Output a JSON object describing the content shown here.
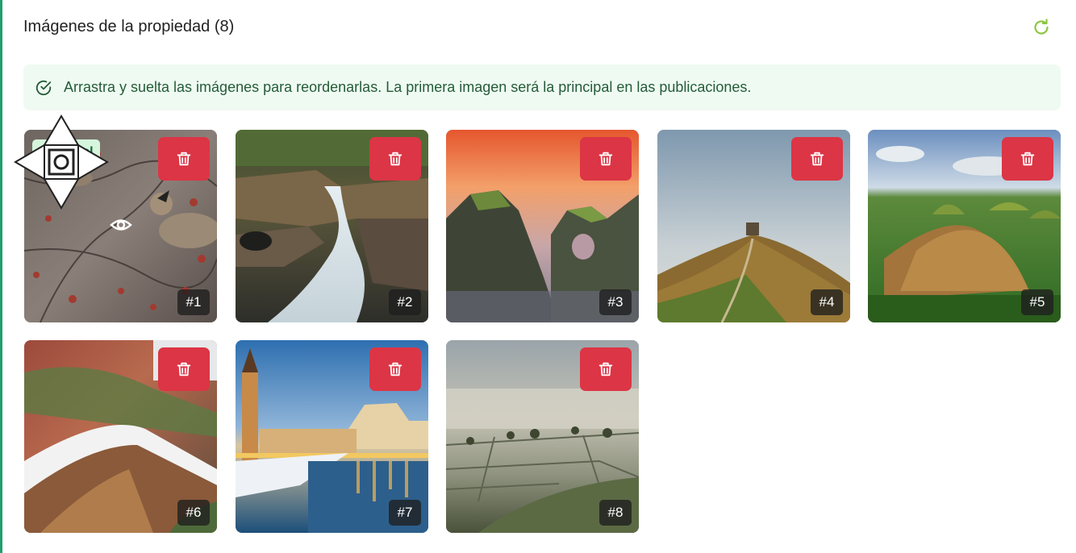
{
  "header": {
    "title": "Imágenes de la propiedad (8)",
    "refresh_icon": "refresh-icon"
  },
  "info": {
    "icon": "check-circle-icon",
    "text": "Arrastra y suelta las imágenes para reordenarlas. La primera imagen será la principal en las publicaciones."
  },
  "gallery": {
    "principal_label": "Principal",
    "delete_icon": "trash-icon",
    "images": [
      {
        "number": "#1"
      },
      {
        "number": "#2"
      },
      {
        "number": "#3"
      },
      {
        "number": "#4"
      },
      {
        "number": "#5"
      },
      {
        "number": "#6"
      },
      {
        "number": "#7"
      },
      {
        "number": "#8"
      }
    ]
  },
  "colors": {
    "accent_green": "#1e9e6a",
    "refresh_green": "#8cc63f",
    "delete_red": "#dc3545",
    "info_bg": "#effaf2",
    "info_text": "#245c38",
    "badge_bg": "#d5f5dc",
    "badge_text": "#176b34"
  }
}
